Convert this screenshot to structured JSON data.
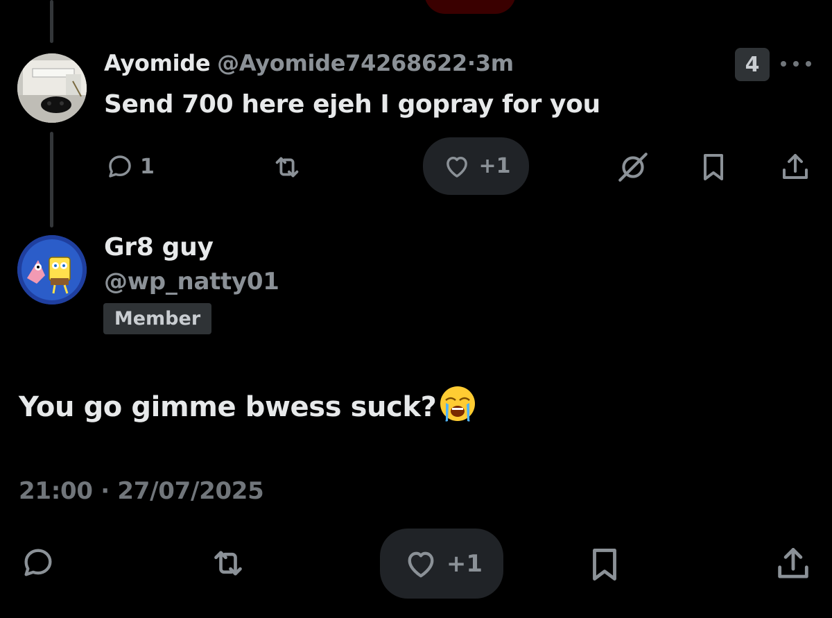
{
  "reply": {
    "name": "Ayomide",
    "handle": "@Ayomide74268622",
    "separator": "·",
    "time": "3m",
    "text": "Send 700 here ejeh I gopray for you",
    "badge_count": "4",
    "actions": {
      "comment_count": "1",
      "like_label": "+1"
    },
    "icons": [
      "comment-icon",
      "retweet-icon",
      "heart-icon",
      "grok-icon",
      "bookmark-icon",
      "share-icon",
      "more-icon"
    ]
  },
  "post": {
    "name": "Gr8 guy",
    "handle": "@wp_natty01",
    "member_label": "Member",
    "text": "You go gimme bwess suck?",
    "emoji": "loudly-crying-face",
    "timestamp": "21:00 · 27/07/2025",
    "actions": {
      "like_label": "+1"
    },
    "icons": [
      "comment-icon",
      "retweet-icon",
      "heart-icon",
      "bookmark-icon",
      "share-icon"
    ]
  },
  "colors": {
    "background": "#000000",
    "text_primary": "#e7e9ea",
    "text_secondary": "#8b9197",
    "badge_bg": "#2f3336",
    "pill_bg": "#202327"
  }
}
